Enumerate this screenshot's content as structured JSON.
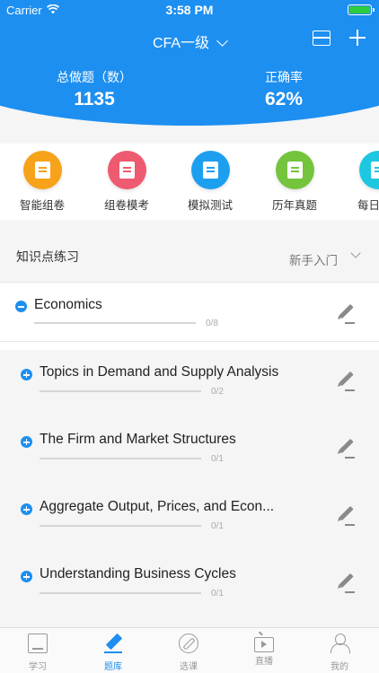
{
  "status_bar": {
    "carrier": "Carrier",
    "time": "3:58 PM"
  },
  "nav": {
    "title": "CFA一级"
  },
  "stats": {
    "total_label": "总做题（数）",
    "total_value": "1135",
    "accuracy_label": "正确率",
    "accuracy_value": "62%"
  },
  "categories": [
    {
      "label": "智能组卷",
      "icon": "list-icon",
      "color": "#f7a21b"
    },
    {
      "label": "组卷模考",
      "icon": "exam-paper-icon",
      "color": "#ee5a6f"
    },
    {
      "label": "模拟测试",
      "icon": "checklist-icon",
      "color": "#1d9ff0"
    },
    {
      "label": "历年真题",
      "icon": "document-icon",
      "color": "#74c43e"
    },
    {
      "label": "每日",
      "icon": "calendar-icon",
      "color": "#1ec7e0"
    }
  ],
  "section": {
    "title": "知识点练习",
    "filter": "新手入门"
  },
  "items": [
    {
      "title": "Economics",
      "count": "0/8",
      "expanded": true
    },
    {
      "title": "Topics in Demand and Supply Analysis",
      "count": "0/2",
      "expanded": false
    },
    {
      "title": "The Firm and Market Structures",
      "count": "0/1",
      "expanded": false
    },
    {
      "title": "Aggregate Output, Prices, and Econ...",
      "count": "0/1",
      "expanded": false
    },
    {
      "title": "Understanding Business Cycles",
      "count": "0/1",
      "expanded": false
    }
  ],
  "tabs": [
    {
      "label": "学习",
      "icon": "book-icon"
    },
    {
      "label": "题库",
      "icon": "pen-icon",
      "active": true
    },
    {
      "label": "选课",
      "icon": "compass-icon"
    },
    {
      "label": "直播",
      "icon": "tv-icon"
    },
    {
      "label": "我的",
      "icon": "user-icon"
    }
  ],
  "colors": {
    "accent": "#1d8ff0"
  }
}
